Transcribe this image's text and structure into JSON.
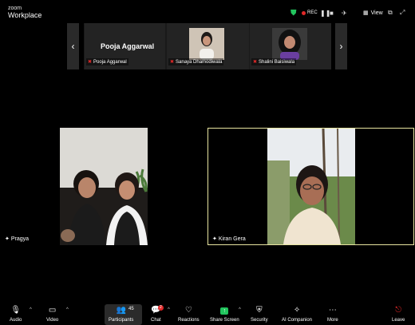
{
  "app": {
    "brand_small": "zoom",
    "brand_name": "Workplace"
  },
  "topbar": {
    "rec_label": "REC",
    "view_label": "View"
  },
  "strip": {
    "tiles": [
      {
        "name_big": "Pooja Aggarwal",
        "label": "Pooja Aggarwal"
      },
      {
        "label": "Sanaya Dhamodiwala"
      },
      {
        "label": "Shalini Baisiwala"
      }
    ]
  },
  "main": {
    "left_tile_label": "Pragya",
    "right_tile_label": "Kiran Gera"
  },
  "toolbar": {
    "audio": "Audio",
    "video": "Video",
    "participants": "Participants",
    "participants_count": "45",
    "chat": "Chat",
    "chat_badge": "2",
    "reactions": "Reactions",
    "share": "Share Screen",
    "security": "Security",
    "ai": "AI Companion",
    "more": "More",
    "leave": "Leave"
  },
  "colors": {
    "active_speaker": "#e8e5a0",
    "share_green": "#22c55e",
    "danger": "#e02828",
    "rec": "#e02828"
  }
}
